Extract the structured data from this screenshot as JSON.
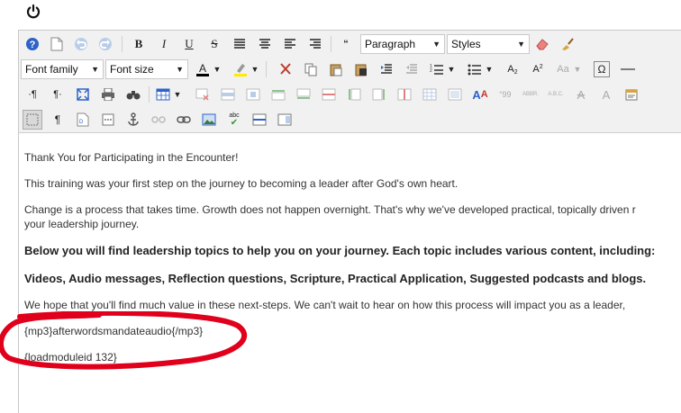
{
  "toolbar": {
    "format_select": "Paragraph",
    "styles_select": "Styles",
    "font_family_select": "Font family",
    "font_size_select": "Font size"
  },
  "content": {
    "heading": "Thank You for Participating in the Encounter!",
    "line1": "This training was your first step on the journey to becoming a leader after God's own heart.",
    "line2a": "Change is a process that takes time. Growth does not happen overnight. That's why we've developed practical, topically driven r",
    "line2b": "your leadership journey.",
    "bold1": "Below you will find leadership topics to help you on your journey. Each topic includes various content, including:",
    "bold2": "Videos, Audio messages, Reflection questions, Scripture, Practical Application, Suggested podcasts and blogs.",
    "line3": "We hope that you'll find much value in these next-steps. We can't wait to hear on how this process will impact you as a leader,",
    "mp3_tag": "{mp3}afterwordsmandateaudio{/mp3}",
    "loadmodule_tag": "{loadmoduleid 132}"
  },
  "colors": {
    "annotation": "#e0001b"
  }
}
